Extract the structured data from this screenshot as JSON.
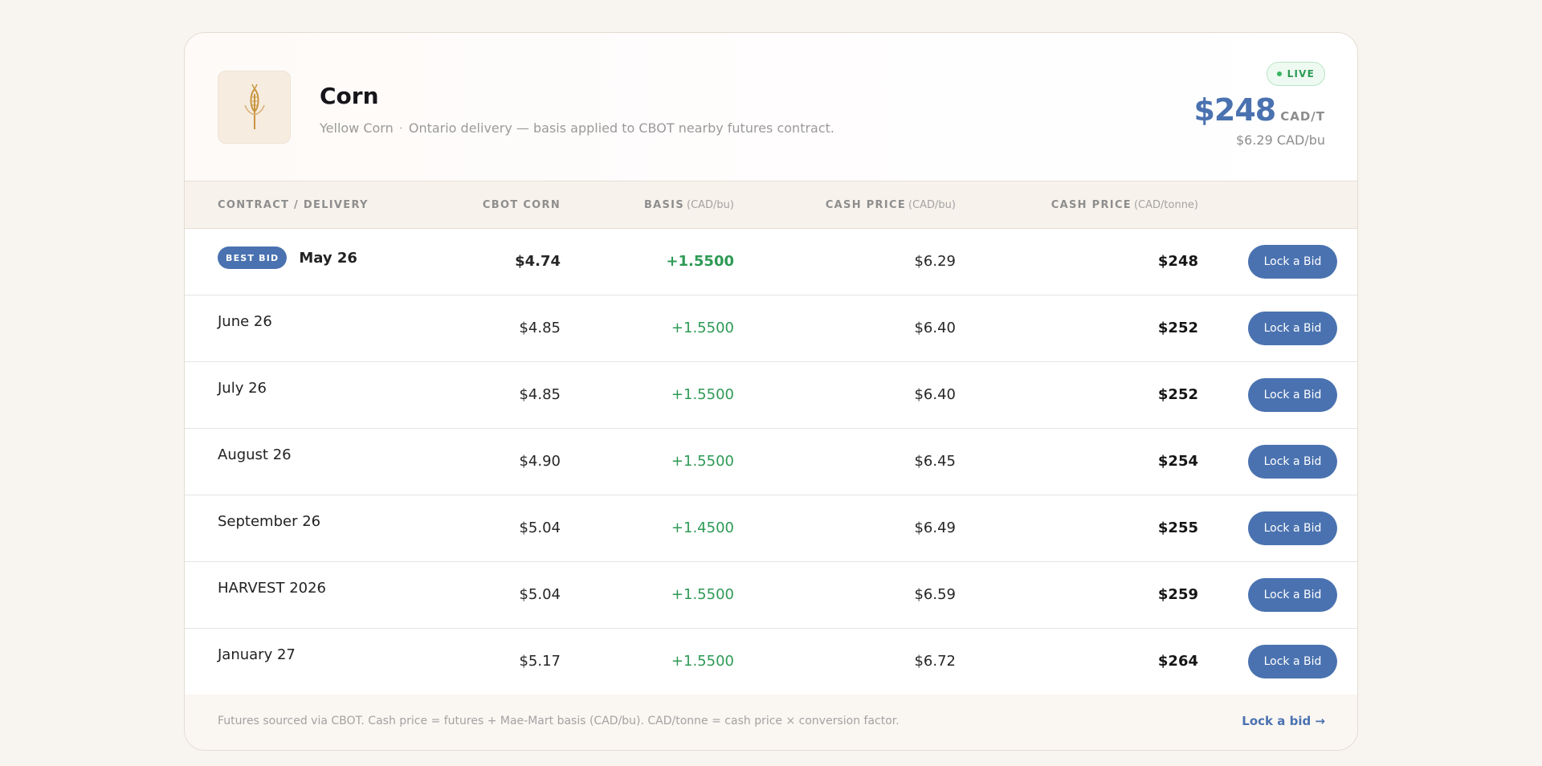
{
  "header": {
    "title": "Corn",
    "variety": "Yellow Corn",
    "separator": "·",
    "description": "Ontario delivery — basis applied to CBOT nearby futures contract.",
    "live_label": "LIVE",
    "price": "$248",
    "price_unit": "CAD/T",
    "price_per_bushel": "$6.29 CAD/bu",
    "icon": "corn-stalk-icon"
  },
  "columns": {
    "contract": "CONTRACT / DELIVERY",
    "cbot": "CBOT CORN",
    "basis": "BASIS",
    "basis_unit": "(CAD/bu)",
    "cash_bu": "CASH PRICE",
    "cash_bu_unit": "(CAD/bu)",
    "cash_t": "CASH PRICE",
    "cash_t_unit": "(CAD/tonne)"
  },
  "best_bid_label": "BEST BID",
  "rows": [
    {
      "contract": "May 26",
      "cbot": "$4.74",
      "basis": "+1.5500",
      "cash_bu": "$6.29",
      "cash_t": "$248",
      "action": "Lock a Bid"
    },
    {
      "contract": "June 26",
      "cbot": "$4.85",
      "basis": "+1.5500",
      "cash_bu": "$6.40",
      "cash_t": "$252",
      "action": "Lock a Bid"
    },
    {
      "contract": "July 26",
      "cbot": "$4.85",
      "basis": "+1.5500",
      "cash_bu": "$6.40",
      "cash_t": "$252",
      "action": "Lock a Bid"
    },
    {
      "contract": "August 26",
      "cbot": "$4.90",
      "basis": "+1.5500",
      "cash_bu": "$6.45",
      "cash_t": "$254",
      "action": "Lock a Bid"
    },
    {
      "contract": "September 26",
      "cbot": "$5.04",
      "basis": "+1.4500",
      "cash_bu": "$6.49",
      "cash_t": "$255",
      "action": "Lock a Bid"
    },
    {
      "contract": "HARVEST 2026",
      "cbot": "$5.04",
      "basis": "+1.5500",
      "cash_bu": "$6.59",
      "cash_t": "$259",
      "action": "Lock a Bid"
    },
    {
      "contract": "January 27",
      "cbot": "$5.17",
      "basis": "+1.5500",
      "cash_bu": "$6.72",
      "cash_t": "$264",
      "action": "Lock a Bid"
    }
  ],
  "footer": {
    "note": "Futures sourced via CBOT. Cash price = futures + Mae-Mart basis (CAD/bu). CAD/tonne = cash price × conversion factor.",
    "link": "Lock a bid →"
  },
  "colors": {
    "accent": "#4a72b0",
    "positive": "#2e9a55",
    "background": "#f8f4ef"
  }
}
